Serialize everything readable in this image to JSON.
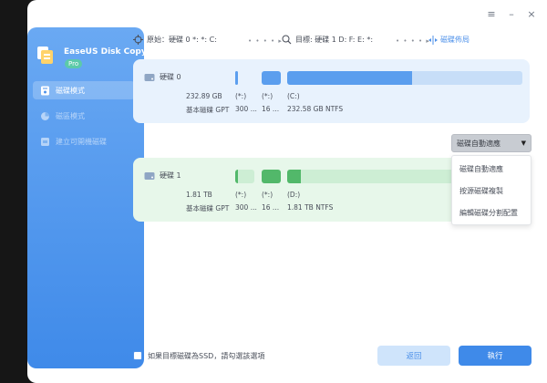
{
  "app": {
    "name": "EaseUS Disk Copy",
    "badge": "Pro"
  },
  "sidebar": {
    "items": [
      {
        "label": "磁碟模式",
        "icon": "disk-mode-icon",
        "active": true
      },
      {
        "label": "磁區模式",
        "icon": "partition-mode-icon",
        "active": false
      },
      {
        "label": "建立可開機磁碟",
        "icon": "bootable-disk-icon",
        "active": false
      }
    ]
  },
  "window_controls": {
    "menu": "≡",
    "minimize": "–",
    "close": "×"
  },
  "path": {
    "source_label": "原始：硬碟 0 *: *: C:",
    "target_label": "目標: 硬碟 1 D: F: E: *:",
    "separator": "• • • • ▸",
    "layout_link": "磁碟佈局"
  },
  "source_disk": {
    "name": "硬碟 0",
    "size": "232.89 GB",
    "type": "基本磁碟 GPT",
    "partitions": [
      {
        "letter": "(*:)",
        "size": "300 ..."
      },
      {
        "letter": "(*:)",
        "size": "16 ..."
      },
      {
        "letter": "(C:)",
        "size": "232.58 GB NTFS"
      }
    ]
  },
  "target_disk": {
    "name": "硬碟 1",
    "size": "1.81 TB",
    "type": "基本磁碟 GPT",
    "partitions": [
      {
        "letter": "(*:)",
        "size": "300 ..."
      },
      {
        "letter": "(*:)",
        "size": "16 ..."
      },
      {
        "letter": "(D:)",
        "size": "1.81 TB NTFS"
      }
    ]
  },
  "dropdown": {
    "selected": "磁碟自動適應",
    "options": [
      "磁碟自動適應",
      "按源磁碟複製",
      "編輯磁碟分割配置"
    ]
  },
  "footer": {
    "ssd_label": "如果目標磁碟為SSD，請勾選該選項",
    "back_label": "返回",
    "run_label": "執行"
  },
  "colors": {
    "accent": "#3f8ae9",
    "source_used": "#5b9eee",
    "target_used": "#52b86a"
  }
}
